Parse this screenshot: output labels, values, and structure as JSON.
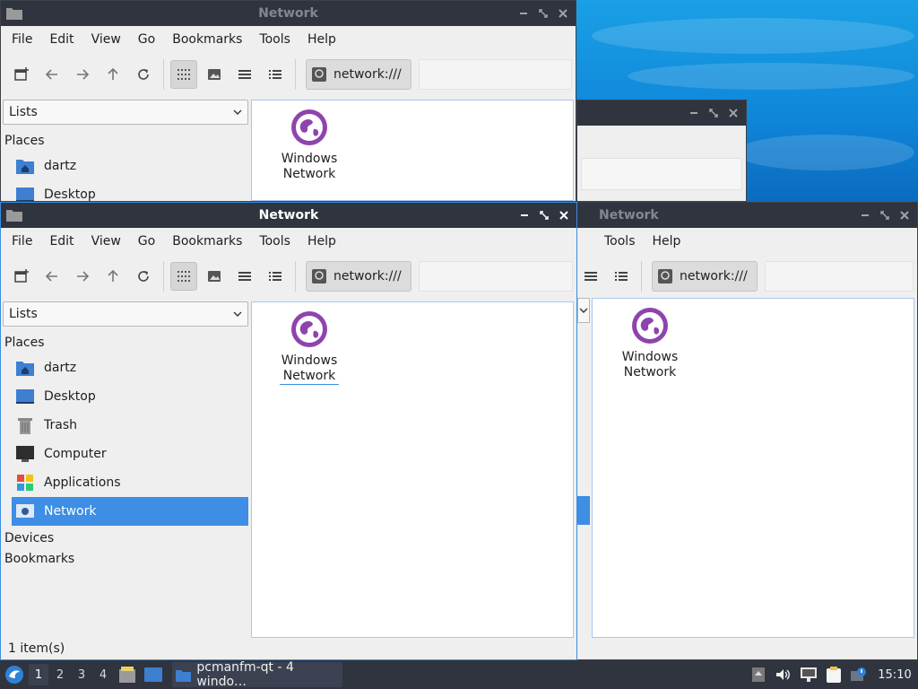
{
  "windows": {
    "title": "Network",
    "menu": [
      "File",
      "Edit",
      "View",
      "Go",
      "Bookmarks",
      "Tools",
      "Help"
    ],
    "location": "network:///",
    "sidebar_mode": "Lists",
    "places_header": "Places",
    "places": [
      {
        "label": "dartz",
        "icon": "home-folder-icon"
      },
      {
        "label": "Desktop",
        "icon": "desktop-icon"
      },
      {
        "label": "Trash",
        "icon": "trash-icon"
      },
      {
        "label": "Computer",
        "icon": "computer-icon"
      },
      {
        "label": "Applications",
        "icon": "applications-icon"
      },
      {
        "label": "Network",
        "icon": "network-icon",
        "selected": true
      }
    ],
    "devices_header": "Devices",
    "bookmarks_header": "Bookmarks",
    "file": {
      "line1": "Windows",
      "line2": "Network"
    },
    "status": "1 item(s)"
  },
  "taskbar": {
    "workspaces": [
      "1",
      "2",
      "3",
      "4"
    ],
    "current_workspace": "1",
    "task_label": "pcmanfm-qt - 4 windo…",
    "clock": "15:10"
  },
  "colors": {
    "accent": "#3d8ee4",
    "titlebar": "#2f343f",
    "network_icon": "#8e44ad"
  }
}
